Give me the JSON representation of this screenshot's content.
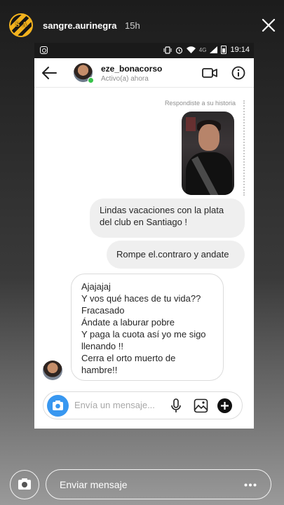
{
  "story": {
    "username": "sangre.aurinegra",
    "time": "15h",
    "avatar_text": "S A",
    "reply_placeholder": "Enviar mensaje"
  },
  "screenshot": {
    "status_bar": {
      "time": "19:14",
      "network": "4G"
    },
    "chat_header": {
      "username": "eze_bonacorso",
      "status": "Activo(a) ahora"
    },
    "reply_note": "Respondiste a su historia",
    "messages": [
      {
        "from": "me",
        "text": "Lindas vacaciones con la plata del club en Santiago !"
      },
      {
        "from": "me",
        "text": "Rompe el.contraro y andate"
      },
      {
        "from": "them",
        "lines": [
          "Ajajajaj",
          "Y vos qué haces de tu vida??",
          "Fracasado",
          "Ándate a laburar pobre",
          "Y paga la cuota así yo me sigo",
          "llenando  !!",
          "Cerra el orto muerto de",
          "hambre!!"
        ]
      }
    ],
    "composer_placeholder": "Envía un mensaje..."
  },
  "colors": {
    "accent_blue": "#3897f0",
    "online_green": "#38c34b",
    "brand_yellow": "#f2b21e"
  }
}
